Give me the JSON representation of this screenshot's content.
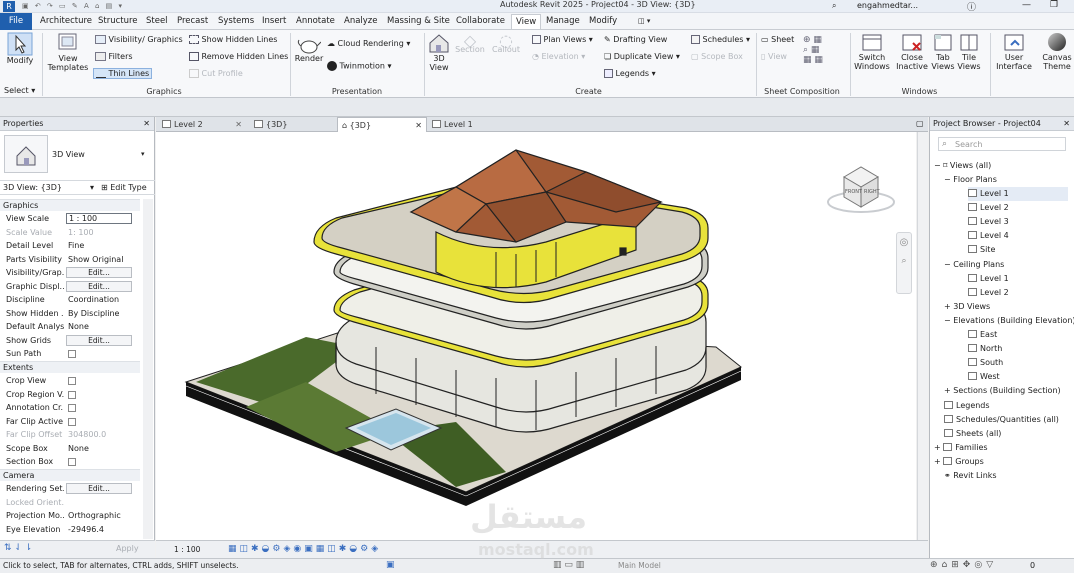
{
  "app": {
    "title": "Autodesk Revit 2025 - Project04 - 3D View: {3D}",
    "user": "engahmedtar..."
  },
  "ribbon_tabs": [
    "File",
    "Architecture",
    "Structure",
    "Steel",
    "Precast",
    "Systems",
    "Insert",
    "Annotate",
    "Analyze",
    "Massing & Site",
    "Collaborate",
    "View",
    "Manage",
    "Modify"
  ],
  "active_tab": "View",
  "ribbon": {
    "modify": "Modify",
    "select": "Select ▾",
    "view_templates": "View Templates",
    "visibility": "Visibility/ Graphics",
    "filters": "Filters",
    "thin_lines": "Thin  Lines",
    "show_hidden": "Show  Hidden  Lines",
    "remove_hidden": "Remove  Hidden Lines",
    "cut_profile": "Cut  Profile",
    "graphics_group": "Graphics",
    "render": "Render",
    "cloud_rendering": "Cloud  Rendering ▾",
    "twinmotion": "Twinmotion ▾",
    "presentation_group": "Presentation",
    "view_3d": "3D View",
    "section": "Section",
    "callout": "Callout",
    "plan_views": "Plan  Views ▾",
    "elevation": "Elevation ▾",
    "drafting_view": "Drafting  View",
    "duplicate_view": "Duplicate  View ▾",
    "legends": "Legends ▾",
    "schedules": "Schedules ▾",
    "scope_box": "Scope  Box",
    "create_group": "Create",
    "sheet": "Sheet",
    "view": "View",
    "sheet_group": "Sheet Composition",
    "switch_windows": "Switch Windows",
    "close_inactive": "Close Inactive",
    "tab_views": "Tab Views",
    "tile_views": "Tile Views",
    "user_interface": "User Interface",
    "canvas_theme": "Canvas Theme",
    "windows_group": "Windows"
  },
  "properties": {
    "title": "Properties",
    "type_name": "3D View",
    "view_selector": "3D View: {3D}",
    "edit_type": "Edit Type",
    "sections": {
      "graphics": "Graphics",
      "extents": "Extents",
      "camera": "Camera"
    },
    "rows": [
      {
        "k": "View Scale",
        "v": "1 : 100"
      },
      {
        "k": "Scale Value",
        "v": "1:  100"
      },
      {
        "k": "Detail Level",
        "v": "Fine"
      },
      {
        "k": "Parts Visibility",
        "v": "Show Original"
      },
      {
        "k": "Visibility/Grap...",
        "v": "Edit..."
      },
      {
        "k": "Graphic Displ...",
        "v": "Edit..."
      },
      {
        "k": "Discipline",
        "v": "Coordination"
      },
      {
        "k": "Show Hidden ...",
        "v": "By Discipline"
      },
      {
        "k": "Default Analys...",
        "v": "None"
      },
      {
        "k": "Show Grids",
        "v": "Edit..."
      },
      {
        "k": "Sun Path",
        "v": ""
      },
      {
        "k": "Crop View",
        "v": ""
      },
      {
        "k": "Crop Region V...",
        "v": ""
      },
      {
        "k": "Annotation Cr...",
        "v": ""
      },
      {
        "k": "Far Clip Active",
        "v": ""
      },
      {
        "k": "Far Clip Offset",
        "v": "304800.0"
      },
      {
        "k": "Scope Box",
        "v": "None"
      },
      {
        "k": "Section Box",
        "v": ""
      },
      {
        "k": "Rendering Set...",
        "v": "Edit..."
      },
      {
        "k": "Locked Orient...",
        "v": ""
      },
      {
        "k": "Projection Mo...",
        "v": "Orthographic"
      },
      {
        "k": "Eye Elevation",
        "v": "-29496.4"
      }
    ],
    "apply": "Apply"
  },
  "view_tabs": [
    "Level 2",
    "{3D}",
    "{3D}",
    "Level 1"
  ],
  "view_bar": {
    "scale": "1 : 100"
  },
  "browser": {
    "title": "Project Browser - Project04",
    "search_placeholder": "Search",
    "items": [
      "Views (all)",
      "Floor Plans",
      "Level 1",
      "Level 2",
      "Level 3",
      "Level 4",
      "Site",
      "Ceiling Plans",
      "Level 1",
      "Level 2",
      "3D Views",
      "Elevations (Building Elevation)",
      "East",
      "North",
      "South",
      "West",
      "Sections (Building Section)",
      "Legends",
      "Schedules/Quantities (all)",
      "Sheets (all)",
      "Families",
      "Groups",
      "Revit Links"
    ]
  },
  "viewcube": {
    "front": "FRONT",
    "right": "RIGHT"
  },
  "status": {
    "hint": "Click to select, TAB for alternates, CTRL adds, SHIFT unselects.",
    "model": "Main Model",
    "zero": "0"
  },
  "watermark": {
    "ar": "مستقل",
    "en": "mostaql.com"
  }
}
